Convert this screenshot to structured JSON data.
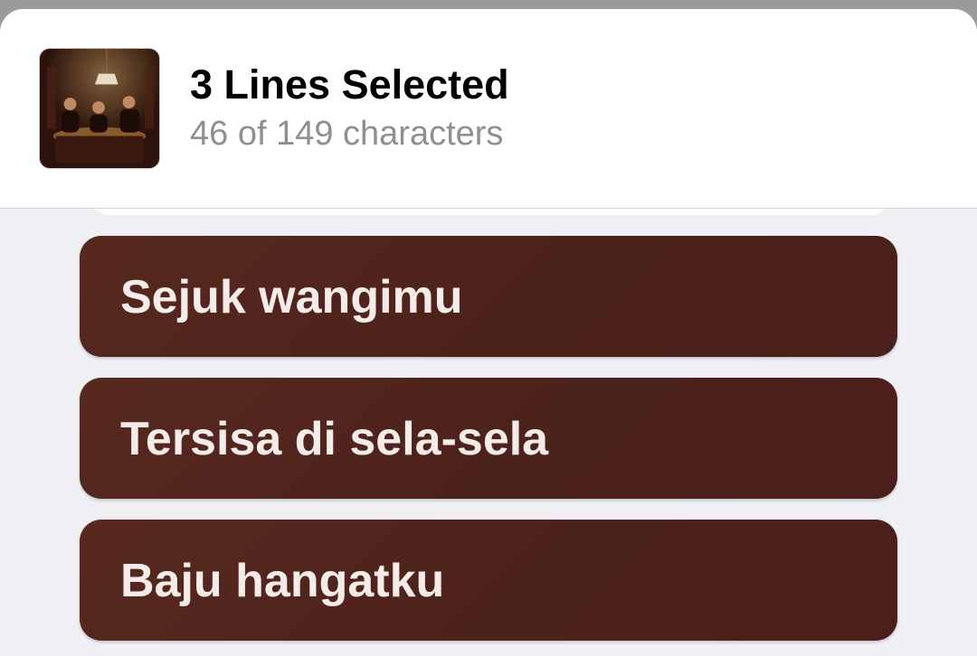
{
  "header": {
    "title": "3 Lines Selected",
    "subtitle": "46 of 149 characters",
    "artwork_icon": "album-artwork-icon"
  },
  "lines": [
    {
      "text": "Sejuk wangimu"
    },
    {
      "text": "Tersisa di sela-sela"
    },
    {
      "text": "Baju hangatku"
    }
  ],
  "colors": {
    "line_card_background": "#4f241d",
    "line_text": "#f5ecea",
    "subtitle": "#8e8e93",
    "sheet_background": "#efeff4"
  }
}
